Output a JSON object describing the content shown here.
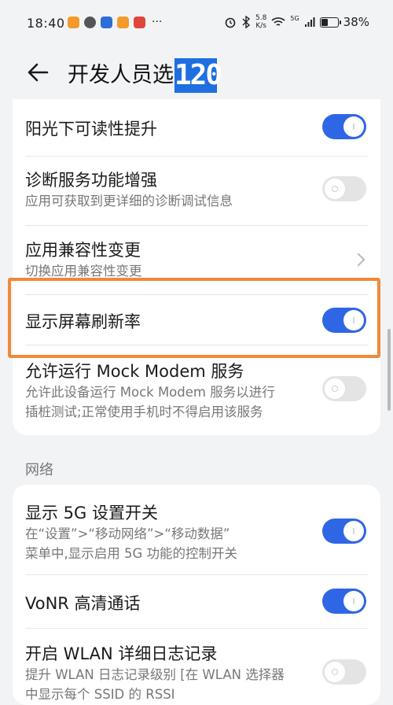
{
  "status_bar": {
    "time": "18:40",
    "more": "···",
    "net_speed_top": "5.8",
    "net_speed_bottom": "K/s",
    "battery": "38%",
    "battery_level": 0.38,
    "network_tag": "5G"
  },
  "header": {
    "title": "开发人员选",
    "badge": "120"
  },
  "card1": {
    "items": [
      {
        "title": "阳光下可读性提升",
        "toggle": "on"
      },
      {
        "title": "诊断服务功能增强",
        "subtitle": "应用可获取到更详细的诊断调试信息",
        "toggle": "off"
      },
      {
        "title": "应用兼容性变更",
        "subtitle": "切换应用兼容性变更"
      },
      {
        "title": "显示屏幕刷新率",
        "toggle": "on"
      },
      {
        "title": "允许运行 Mock Modem 服务",
        "subtitle_lines": [
          "允许此设备运行 Mock Modem 服务以进行",
          "插桩测试;正常使用手机时不得启用该服务"
        ],
        "toggle": "off"
      }
    ]
  },
  "section": {
    "network_label": "网络"
  },
  "card2": {
    "items": [
      {
        "title": "显示 5G 设置开关",
        "subtitle_lines": [
          "在“设置”>“移动网络”>“移动数据”",
          "菜单中,显示启用 5G 功能的控制开关"
        ],
        "toggle": "on"
      },
      {
        "title": "VoNR 高清通话",
        "toggle": "on"
      },
      {
        "title": "开启 WLAN 详细日志记录",
        "subtitle_lines": [
          "提升 WLAN 日志记录级别 [在 WLAN 选择器",
          "中显示每个 SSID 的 RSSI"
        ],
        "toggle": "off"
      }
    ]
  },
  "colors": {
    "accent": "#2f66e6",
    "highlight": "#f0893b",
    "badge": "#1f6fe0"
  }
}
